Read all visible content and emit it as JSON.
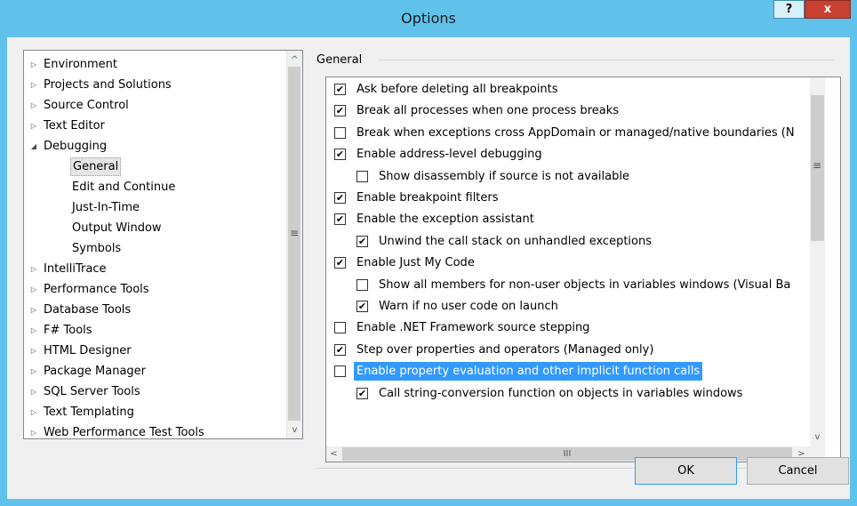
{
  "window": {
    "title": "Options",
    "help": "?",
    "close": "x"
  },
  "tree": {
    "items": [
      {
        "label": "Environment",
        "arrow": "▷",
        "level": 0
      },
      {
        "label": "Projects and Solutions",
        "arrow": "▷",
        "level": 0
      },
      {
        "label": "Source Control",
        "arrow": "▷",
        "level": 0
      },
      {
        "label": "Text Editor",
        "arrow": "▷",
        "level": 0
      },
      {
        "label": "Debugging",
        "arrow": "◢",
        "level": 0
      },
      {
        "label": "General",
        "arrow": "",
        "level": 1,
        "selected": true
      },
      {
        "label": "Edit and Continue",
        "arrow": "",
        "level": 1
      },
      {
        "label": "Just-In-Time",
        "arrow": "",
        "level": 1
      },
      {
        "label": "Output Window",
        "arrow": "",
        "level": 1
      },
      {
        "label": "Symbols",
        "arrow": "",
        "level": 1
      },
      {
        "label": "IntelliTrace",
        "arrow": "▷",
        "level": 0
      },
      {
        "label": "Performance Tools",
        "arrow": "▷",
        "level": 0
      },
      {
        "label": "Database Tools",
        "arrow": "▷",
        "level": 0
      },
      {
        "label": "F# Tools",
        "arrow": "▷",
        "level": 0
      },
      {
        "label": "HTML Designer",
        "arrow": "▷",
        "level": 0
      },
      {
        "label": "Package Manager",
        "arrow": "▷",
        "level": 0
      },
      {
        "label": "SQL Server Tools",
        "arrow": "▷",
        "level": 0
      },
      {
        "label": "Text Templating",
        "arrow": "▷",
        "level": 0
      },
      {
        "label": "Web Performance Test Tools",
        "arrow": "▷",
        "level": 0
      }
    ]
  },
  "group": {
    "label": "General"
  },
  "options": [
    {
      "label": "Ask before deleting all breakpoints",
      "checked": true,
      "level": 0
    },
    {
      "label": "Break all processes when one process breaks",
      "checked": true,
      "level": 0
    },
    {
      "label": "Break when exceptions cross AppDomain or managed/native boundaries (N",
      "checked": false,
      "level": 0
    },
    {
      "label": "Enable address-level debugging",
      "checked": true,
      "level": 0
    },
    {
      "label": "Show disassembly if source is not available",
      "checked": false,
      "level": 1
    },
    {
      "label": "Enable breakpoint filters",
      "checked": true,
      "level": 0
    },
    {
      "label": "Enable the exception assistant",
      "checked": true,
      "level": 0
    },
    {
      "label": "Unwind the call stack on unhandled exceptions",
      "checked": true,
      "level": 1
    },
    {
      "label": "Enable Just My Code",
      "checked": true,
      "level": 0
    },
    {
      "label": "Show all members for non-user objects in variables windows (Visual Ba",
      "checked": false,
      "level": 1
    },
    {
      "label": "Warn if no user code on launch",
      "checked": true,
      "level": 1
    },
    {
      "label": "Enable .NET Framework source stepping",
      "checked": false,
      "level": 0
    },
    {
      "label": "Step over properties and operators (Managed only)",
      "checked": true,
      "level": 0
    },
    {
      "label": "Enable property evaluation and other implicit function calls",
      "checked": false,
      "level": 0,
      "highlighted": true
    },
    {
      "label": "Call string-conversion function on objects in variables windows",
      "checked": true,
      "level": 1
    }
  ],
  "buttons": {
    "ok": "OK",
    "cancel": "Cancel"
  },
  "scroll": {
    "grip": "≡",
    "hgrip": "III",
    "up": "^",
    "down": "v",
    "left": "<",
    "right": ">"
  },
  "colors": {
    "titlebar": "#60c2ea",
    "highlight": "#3399ff",
    "close": "#c84031"
  }
}
